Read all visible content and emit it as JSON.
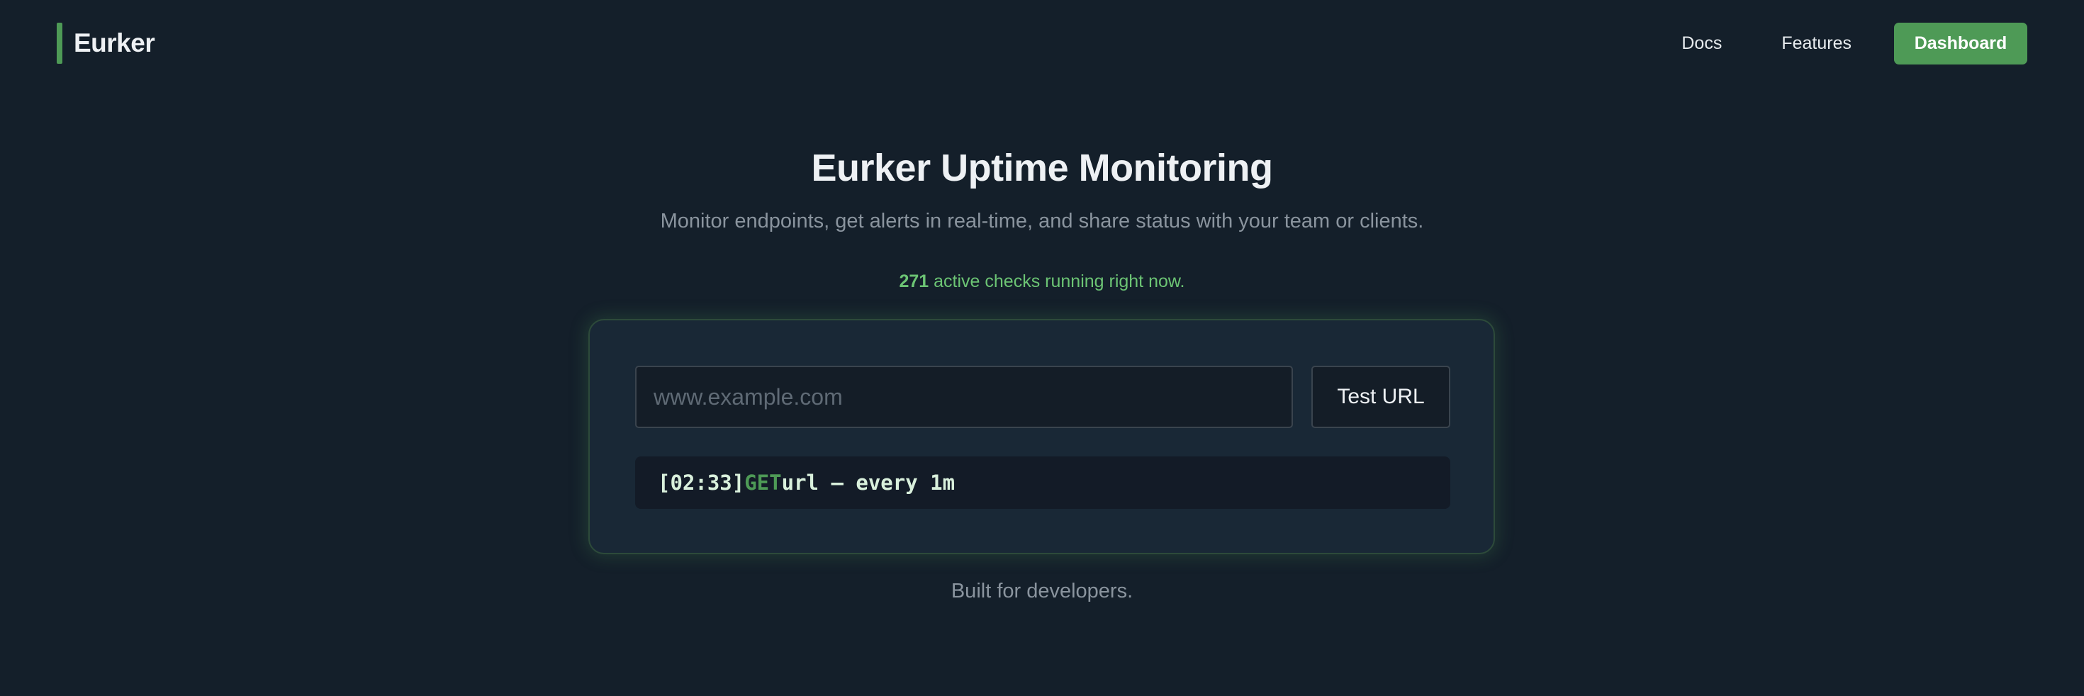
{
  "brand": {
    "name": "Eurker",
    "accent_color": "#4e9a56"
  },
  "nav": {
    "links": [
      "Docs",
      "Features"
    ],
    "cta_label": "Dashboard"
  },
  "hero": {
    "title": "Eurker Uptime Monitoring",
    "subtitle": "Monitor endpoints, get alerts in real-time, and share status with your team or clients.",
    "active_count": "271",
    "active_text": " active checks running right now."
  },
  "checker": {
    "url_placeholder": "www.example.com",
    "url_value": "",
    "test_button_label": "Test URL",
    "log": {
      "time": "[02:33]",
      "method": "GET",
      "rest": "url – every 1m"
    }
  },
  "footer": {
    "note": "Built for developers."
  },
  "colors": {
    "background": "#141f2a",
    "card": "#192836",
    "primary": "#4e9a56",
    "active_text": "#6cc474"
  }
}
